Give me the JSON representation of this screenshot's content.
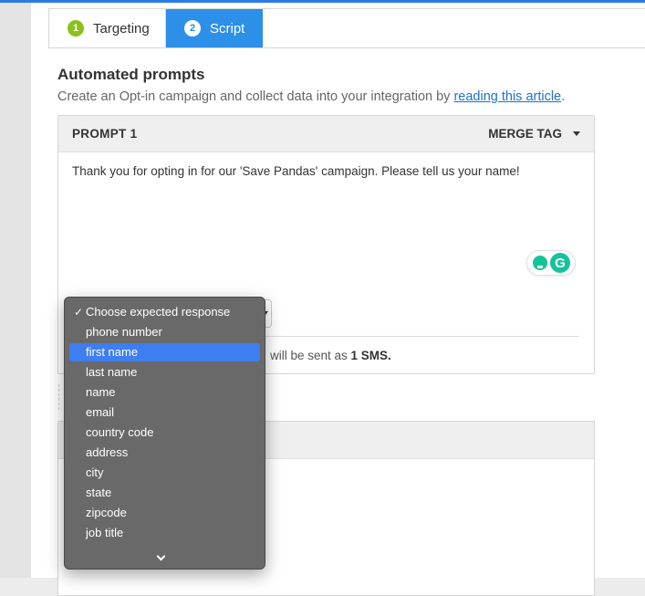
{
  "tabs": [
    {
      "number": "1",
      "label": "Targeting",
      "active": false
    },
    {
      "number": "2",
      "label": "Script",
      "active": true
    }
  ],
  "section": {
    "title": "Automated prompts",
    "description_prefix": "Create an Opt-in campaign and collect data into your integration by ",
    "link_text": "reading this article",
    "description_suffix": "."
  },
  "prompt": {
    "title": "PROMPT 1",
    "merge_tag_label": "MERGE TAG",
    "message": "Thank you for opting in for our 'Save Pandas' campaign. Please tell us your name!",
    "sms_note_prefix": "will be sent as ",
    "sms_count": "1 SMS."
  },
  "expected_response_menu": {
    "selected": "Choose expected response",
    "highlighted": "first name",
    "options": [
      "Choose expected response",
      "phone number",
      "first name",
      "last name",
      "name",
      "email",
      "country code",
      "address",
      "city",
      "state",
      "zipcode",
      "job title"
    ]
  },
  "colors": {
    "accent": "#2c8fe8",
    "step_done": "#8ac11b",
    "link": "#1a73c9",
    "menu_highlight": "#3d7ef0",
    "grammarly": "#15c39a"
  }
}
